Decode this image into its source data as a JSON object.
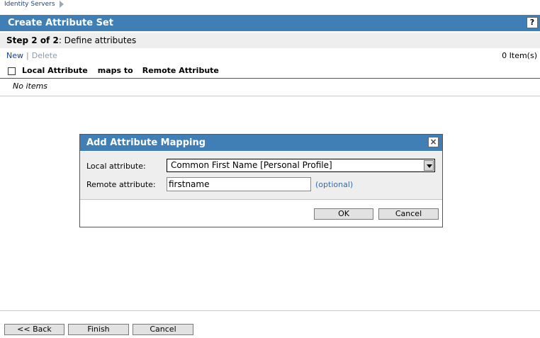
{
  "breadcrumb": {
    "item": "Identity Servers"
  },
  "titlebar": {
    "title": "Create Attribute Set",
    "help_label": "?"
  },
  "step": {
    "prefix": "Step 2 of 2",
    "text": ": Define attributes"
  },
  "toolbar": {
    "new_label": "New",
    "separator": "|",
    "delete_label": "Delete",
    "count": "0 Item(s)"
  },
  "table": {
    "columns": [
      "Local Attribute",
      "maps to",
      "Remote Attribute"
    ],
    "empty_text": "No items"
  },
  "dialog": {
    "title": "Add Attribute Mapping",
    "close_label": "×",
    "local_label": "Local attribute:",
    "local_value": "Common First Name [Personal Profile]",
    "remote_label": "Remote attribute:",
    "remote_value": "firstname",
    "optional_text": "(optional)",
    "ok_label": "OK",
    "cancel_label": "Cancel"
  },
  "footer": {
    "back_label": "<< Back",
    "finish_label": "Finish",
    "cancel_label": "Cancel"
  },
  "colors": {
    "header_blue": "#3f7fb5",
    "panel_gray": "#eeeeee",
    "link_blue": "#1b3f8c"
  }
}
